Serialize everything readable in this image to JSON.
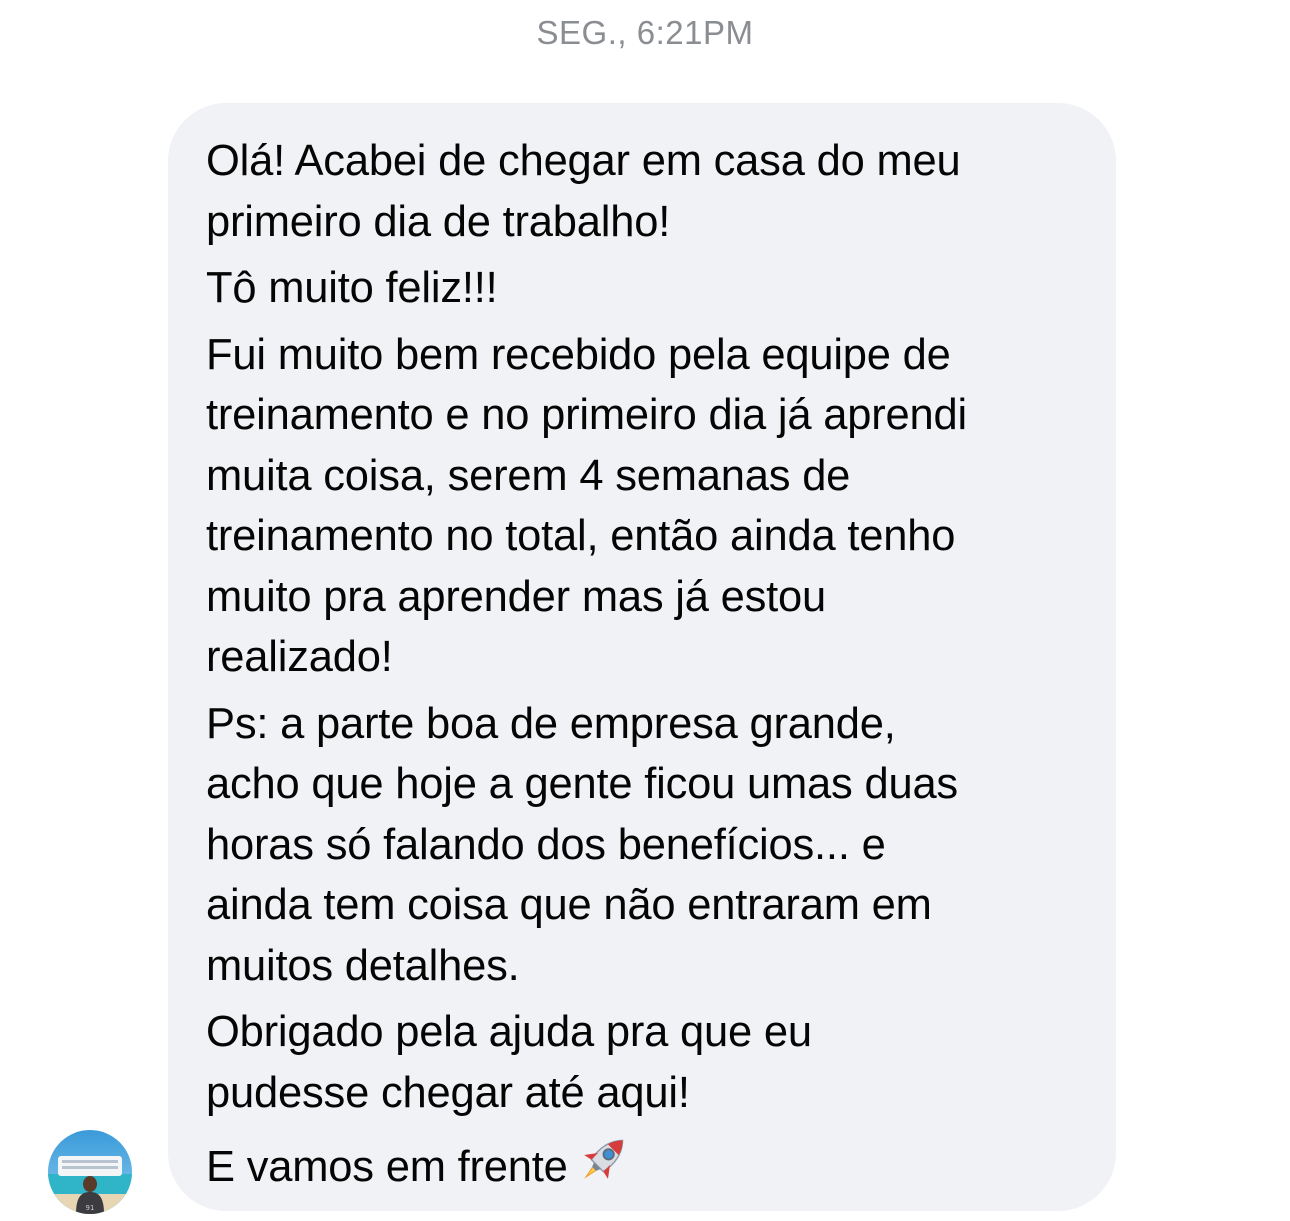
{
  "conversation": {
    "timestamp": "SEG., 6:21PM"
  },
  "message": {
    "paragraphs": [
      [
        "Olá! Acabei de chegar em casa do meu",
        "primeiro dia de trabalho!"
      ],
      [
        "Tô muito feliz!!!"
      ],
      [
        "Fui muito bem recebido pela equipe de",
        "treinamento e no primeiro dia já aprendi",
        "muita coisa, serem 4 semanas de",
        "treinamento no total, então ainda tenho",
        "muito pra aprender mas já estou",
        "realizado!"
      ],
      [
        "Ps: a parte boa de empresa grande,",
        "acho que hoje a gente ficou umas duas",
        "horas só falando dos benefícios... e",
        "ainda tem coisa que não entraram em",
        "muitos detalhes."
      ],
      [
        "Obrigado pela ajuda pra que eu",
        "pudesse chegar até aqui!"
      ]
    ],
    "last_line": "E vamos em frente",
    "last_line_emoji": "rocket-icon"
  },
  "sender": {
    "avatar_icon": "avatar-photo"
  },
  "colors": {
    "bubble_bg": "#f1f2f5",
    "text": "#050505",
    "timestamp": "#8a8d91"
  }
}
